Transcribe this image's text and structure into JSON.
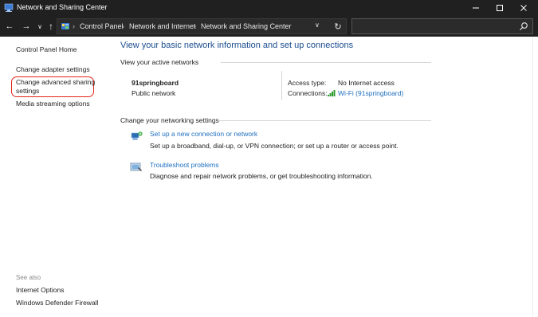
{
  "window": {
    "title": "Network and Sharing Center",
    "controls": {
      "minimize": "—",
      "maximize": "☐",
      "close": "✕"
    }
  },
  "address": {
    "back": "←",
    "forward": "→",
    "recent": "∨",
    "up": "↑",
    "breadcrumbs": [
      "Control Panel",
      "Network and Internet",
      "Network and Sharing Center"
    ],
    "separator": "›",
    "dropdown": "∨",
    "refresh": "↻",
    "search_placeholder": ""
  },
  "sidebar": {
    "home": "Control Panel Home",
    "links": [
      "Change adapter settings",
      "Change advanced sharing",
      "settings",
      "Media streaming options"
    ],
    "see_also_label": "See also",
    "see_also": [
      "Internet Options",
      "Windows Defender Firewall"
    ]
  },
  "main": {
    "title": "View your basic network information and set up connections",
    "active_networks_heading": "View your active networks",
    "network": {
      "name": "91springboard",
      "type": "Public network",
      "access_type_label": "Access type:",
      "access_type_value": "No Internet access",
      "connections_label": "Connections:",
      "connection_link": "Wi-Fi (91springboard)"
    },
    "settings_heading": "Change your networking settings",
    "tasks": [
      {
        "icon": "new-connection-icon",
        "link": "Set up a new connection or network",
        "desc": "Set up a broadband, dial-up, or VPN connection; or set up a router or access point."
      },
      {
        "icon": "troubleshoot-icon",
        "link": "Troubleshoot problems",
        "desc": "Diagnose and repair network problems, or get troubleshooting information."
      }
    ]
  },
  "colors": {
    "titlebar": "#202020",
    "link": "#1f6fbf",
    "heading_blue": "#1a4d8f",
    "highlight": "#e2231a"
  }
}
